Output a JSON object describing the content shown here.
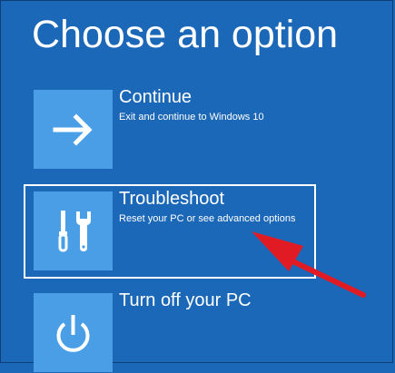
{
  "page_title": "Choose an option",
  "colors": {
    "background": "#1c68b8",
    "tile": "#4a9ee6",
    "text": "#ffffff",
    "annotation_arrow": "#e01b24"
  },
  "options": [
    {
      "label": "Continue",
      "description": "Exit and continue to Windows 10",
      "icon": "arrow-right-icon"
    },
    {
      "label": "Troubleshoot",
      "description": "Reset your PC or see advanced options",
      "icon": "tools-icon",
      "focused": true
    },
    {
      "label": "Turn off your PC",
      "description": "",
      "icon": "power-icon"
    }
  ]
}
